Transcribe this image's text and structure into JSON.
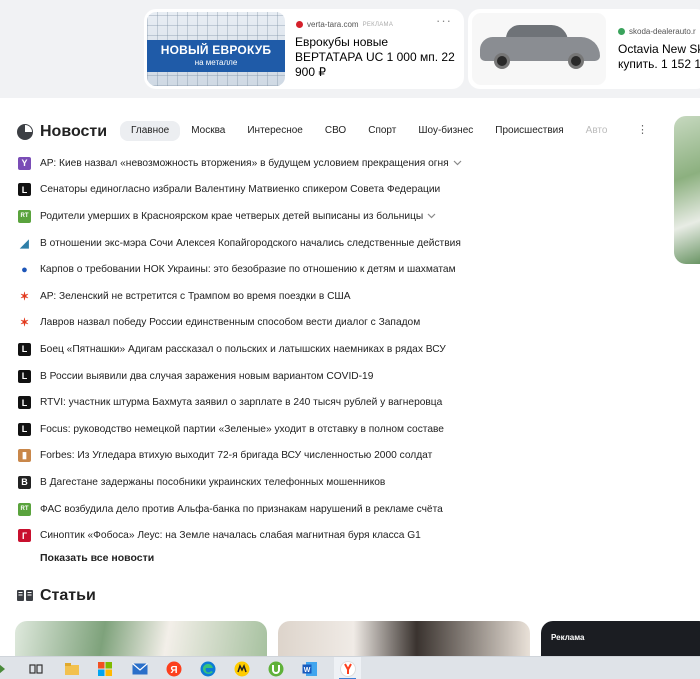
{
  "ads": [
    {
      "image_title": "НОВЫЙ ЕВРОКУБ",
      "image_subtitle": "на металле",
      "source": "verta-tara.com",
      "tag": "РЕКЛАМА",
      "more": "···",
      "title": "Еврокубы новые ВЕРТАТАРА UC 1 000 мп. 22 900 ₽"
    },
    {
      "source": "skoda-dealerauto.r",
      "title_line1": "Octavia New Sk",
      "title_line2": "купить. 1 152 10"
    }
  ],
  "news": {
    "title": "Новости",
    "tabs": [
      "Главное",
      "Москва",
      "Интересное",
      "СВО",
      "Спорт",
      "Шоу-бизнес",
      "Происшествия",
      "Авто"
    ],
    "active_tab": "Главное",
    "more": "⋮",
    "items": [
      {
        "text": "АР: Киев назвал «невозможность вторжения» в будущем условием прекращения огня",
        "icon": "Y",
        "color": "#7a4db6",
        "chevron": true
      },
      {
        "text": "Сенаторы единогласно избрали Валентину Матвиенко спикером Совета Федерации",
        "icon": "L",
        "color": "#111111",
        "chevron": false
      },
      {
        "text": "Родители умерших в Красноярском крае четверых детей выписаны из больницы",
        "icon": "RT",
        "color": "#5aa33d",
        "chevron": true
      },
      {
        "text": "В отношении экс-мэра Сочи Алексея Копайгородского начались следственные действия",
        "icon": "◢",
        "color": "#2f7fa8",
        "chevron": false
      },
      {
        "text": "Карпов о требовании НОК Украины: это безобразие по отношению к детям и шахматам",
        "icon": "●",
        "color": "#1d56b8",
        "chevron": false
      },
      {
        "text": "АР: Зеленский не встретится с Трампом во время поездки в США",
        "icon": "✶",
        "color": "#e23a1e",
        "chevron": false
      },
      {
        "text": "Лавров назвал победу России единственным способом вести диалог с Западом",
        "icon": "✶",
        "color": "#e23a1e",
        "chevron": false
      },
      {
        "text": "Боец «Пятнашки» Адигам рассказал о польских и латышских наемниках в рядах ВСУ",
        "icon": "L",
        "color": "#111111",
        "chevron": false
      },
      {
        "text": "В России выявили два случая заражения новым вариантом COVID-19",
        "icon": "L",
        "color": "#111111",
        "chevron": false
      },
      {
        "text": "RTVI: участник штурма Бахмута заявил о зарплате в 240 тысяч рублей у вагнеровца",
        "icon": "L",
        "color": "#111111",
        "chevron": false
      },
      {
        "text": "Focus: руководство немецкой партии «Зеленые» уходит в отставку в полном составе",
        "icon": "L",
        "color": "#111111",
        "chevron": false
      },
      {
        "text": "Forbes: Из Угледара втихую выходит 72-я бригада ВСУ численностью 2000 солдат",
        "icon": "▮",
        "color": "#c9874a",
        "chevron": false
      },
      {
        "text": "В Дагестане задержаны пособники украинских телефонных мошенников",
        "icon": "B",
        "color": "#222222",
        "chevron": false
      },
      {
        "text": "ФАС возбудила дело против Альфа-банка по признакам нарушений в рекламе счёта",
        "icon": "RT",
        "color": "#5aa33d",
        "chevron": false
      },
      {
        "text": "Синоптик «Фобоса» Леус: на Земле началась слабая магнитная буря класса G1",
        "icon": "Г",
        "color": "#c8102e",
        "chevron": false
      }
    ],
    "show_all": "Показать все новости"
  },
  "articles": {
    "title": "Статьи",
    "ad_label": "Реклама"
  },
  "taskbar": {
    "icons": [
      "task-view-icon",
      "file-explorer-icon",
      "store-icon",
      "mail-icon",
      "yandex-music-icon",
      "edge-icon",
      "yandex-market-icon",
      "torrent-icon",
      "word-icon",
      "yandex-browser-icon"
    ]
  }
}
